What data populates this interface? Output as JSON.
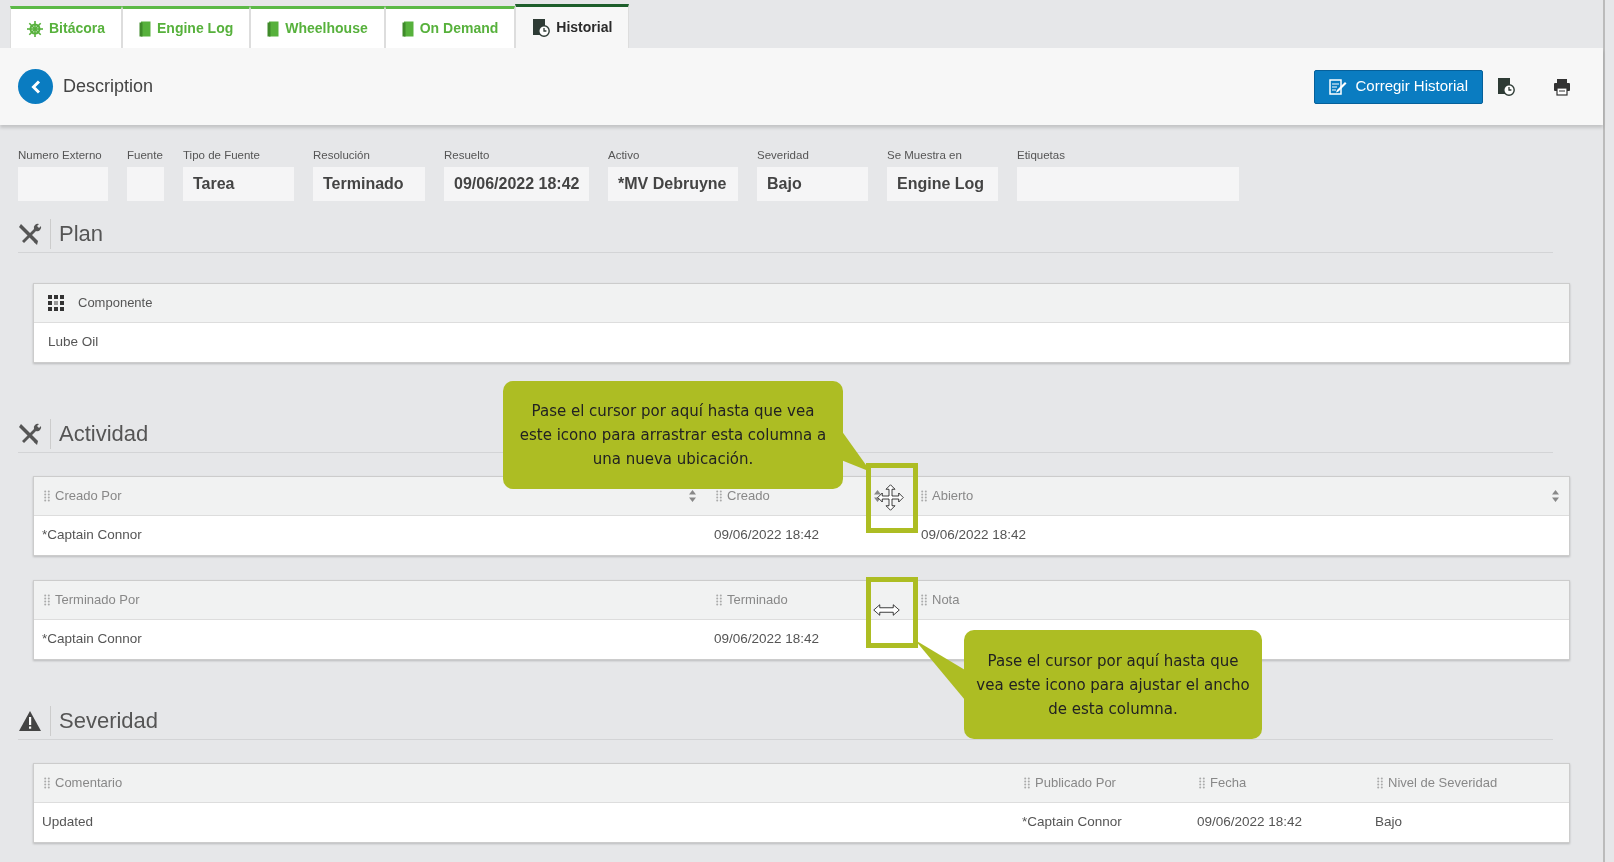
{
  "tabs": [
    {
      "label": "Bitácora",
      "kind": "wheel",
      "selected": false
    },
    {
      "label": "Engine Log",
      "kind": "book",
      "selected": false
    },
    {
      "label": "Wheelhouse",
      "kind": "book",
      "selected": false
    },
    {
      "label": "On Demand",
      "kind": "book",
      "selected": false
    },
    {
      "label": "Historial",
      "kind": "history",
      "selected": true
    }
  ],
  "header": {
    "title": "Description",
    "button": "Corregir Historial"
  },
  "fields": [
    {
      "label": "Numero Externo"
    },
    {
      "label": "Fuente"
    },
    {
      "label": "Tipo de Fuente",
      "value": "Tarea"
    },
    {
      "label": "Resolución",
      "value": "Terminado"
    },
    {
      "label": "Resuelto",
      "value": "09/06/2022 18:42"
    },
    {
      "label": "Activo",
      "value": "*MV Debruyne"
    },
    {
      "label": "Severidad",
      "value": "Bajo"
    },
    {
      "label": "Se Muestra en",
      "value": "Engine Log"
    },
    {
      "label": "Etiquetas"
    }
  ],
  "sections": [
    {
      "title": "Plan",
      "kind": "tools",
      "tables": [
        {
          "columns": [
            {
              "label": "Componente",
              "kind": "grid",
              "sortable": false
            }
          ],
          "rows": [
            [
              "Lube Oil"
            ]
          ]
        }
      ]
    },
    {
      "title": "Actividad",
      "kind": "tools",
      "tables": [
        {
          "columns": [
            {
              "label": "Creado Por",
              "kind": "drag",
              "sortable": true
            },
            {
              "label": "Creado",
              "kind": "drag",
              "sortable": true
            },
            {
              "label": "Abierto",
              "kind": "drag",
              "sortable": true
            }
          ],
          "rows": [
            [
              "*Captain Connor",
              "09/06/2022 18:42",
              "09/06/2022 18:42"
            ]
          ]
        },
        {
          "columns": [
            {
              "label": "Terminado Por",
              "kind": "drag",
              "sortable": false
            },
            {
              "label": "Terminado",
              "kind": "drag",
              "sortable": false
            },
            {
              "label": "Nota",
              "kind": "drag",
              "sortable": false
            }
          ],
          "rows": [
            [
              "*Captain Connor",
              "09/06/2022 18:42",
              ""
            ]
          ]
        }
      ]
    },
    {
      "title": "Severidad",
      "kind": "warning",
      "tables": [
        {
          "columns": [
            {
              "label": "Comentario",
              "kind": "drag",
              "sortable": false
            },
            {
              "label": "Publicado Por",
              "kind": "drag",
              "sortable": false
            },
            {
              "label": "Fecha",
              "kind": "drag",
              "sortable": false
            },
            {
              "label": "Nivel de Severidad",
              "kind": "drag",
              "sortable": false
            }
          ],
          "rows": [
            [
              "Updated",
              "*Captain Connor",
              "09/06/2022 18:42",
              "Bajo"
            ]
          ]
        }
      ]
    }
  ],
  "callouts": [
    {
      "text": "Pase el cursor por aquí hasta que vea este icono para arrastrar esta columna a una nueva ubicación.",
      "kind": "move"
    },
    {
      "text": "Pase el cursor por aquí hasta que vea este icono para ajustar el ancho de esta columna.",
      "kind": "resize"
    }
  ]
}
